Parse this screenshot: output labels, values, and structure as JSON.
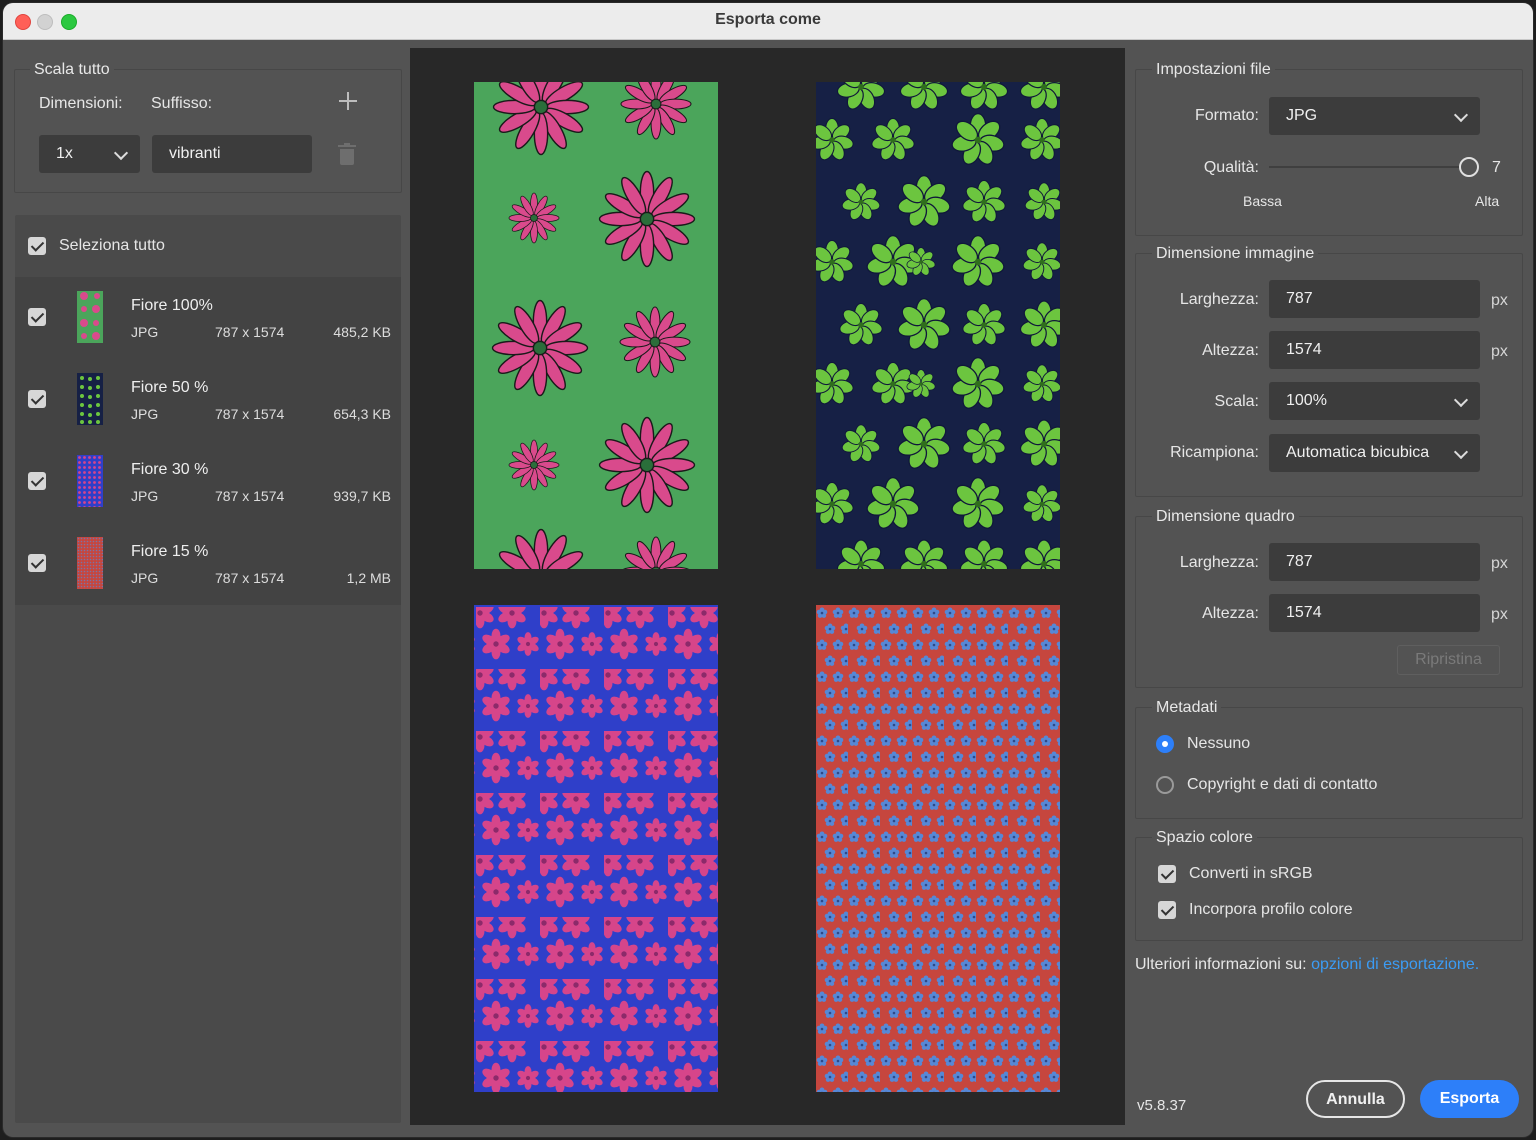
{
  "window": {
    "title": "Esporta come"
  },
  "scale_all": {
    "group_label": "Scala tutto",
    "size_label": "Dimensioni:",
    "suffix_label": "Suffisso:",
    "size_value": "1x",
    "suffix_value": "vibranti",
    "add_icon": "plus-icon",
    "delete_icon": "trash-icon"
  },
  "list": {
    "select_all_label": "Seleziona tutto",
    "select_all_checked": true,
    "items": [
      {
        "name": "Fiore 100%",
        "format": "JPG",
        "dimensions": "787 x 1574",
        "size": "485,2 KB",
        "checked": true,
        "bg": "#4ba55b",
        "fg": "#d94a8c"
      },
      {
        "name": "Fiore 50 %",
        "format": "JPG",
        "dimensions": "787 x 1574",
        "size": "654,3 KB",
        "checked": true,
        "bg": "#162045",
        "fg": "#6cc53f"
      },
      {
        "name": "Fiore 30 %",
        "format": "JPG",
        "dimensions": "787 x 1574",
        "size": "939,7 KB",
        "checked": true,
        "bg": "#2f3fc9",
        "fg": "#d6458a"
      },
      {
        "name": "Fiore 15 %",
        "format": "JPG",
        "dimensions": "787 x 1574",
        "size": "1,2 MB",
        "checked": true,
        "bg": "#c6463e",
        "fg": "#5688d6"
      }
    ]
  },
  "file_settings": {
    "group_label": "Impostazioni file",
    "format_label": "Formato:",
    "format_value": "JPG",
    "quality_label": "Qualità:",
    "quality_value": "7",
    "quality_fraction": 1.0,
    "quality_low": "Bassa",
    "quality_high": "Alta"
  },
  "image_size": {
    "group_label": "Dimensione immagine",
    "width_label": "Larghezza:",
    "width_value": "787",
    "height_label": "Altezza:",
    "height_value": "1574",
    "scale_label": "Scala:",
    "scale_value": "100%",
    "resample_label": "Ricampiona:",
    "resample_value": "Automatica bicubica",
    "unit": "px"
  },
  "canvas_size": {
    "group_label": "Dimensione quadro",
    "width_label": "Larghezza:",
    "width_value": "787",
    "height_label": "Altezza:",
    "height_value": "1574",
    "unit": "px",
    "reset_label": "Ripristina"
  },
  "metadata": {
    "group_label": "Metadati",
    "option_none": "Nessuno",
    "option_copyright": "Copyright e dati di contatto",
    "selected": "none"
  },
  "color_space": {
    "group_label": "Spazio colore",
    "convert_label": "Converti in sRGB",
    "convert_checked": true,
    "embed_label": "Incorpora profilo colore",
    "embed_checked": true
  },
  "info": {
    "text": "Ulteriori informazioni su:",
    "link": "opzioni di esportazione."
  },
  "footer": {
    "version": "v5.8.37",
    "cancel_label": "Annulla",
    "export_label": "Esporta"
  },
  "colors": {
    "accent": "#2d7ff9",
    "link": "#3b9cf5"
  }
}
